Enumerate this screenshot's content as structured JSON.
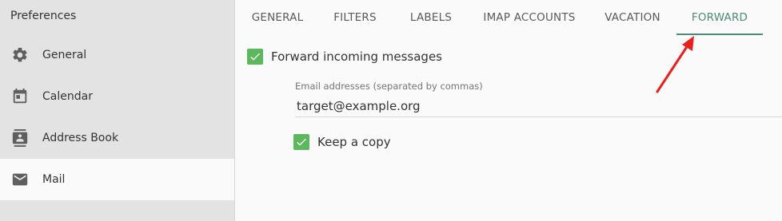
{
  "sidebar": {
    "title": "Preferences",
    "items": [
      {
        "label": "General",
        "icon": "gear-icon"
      },
      {
        "label": "Calendar",
        "icon": "calendar-icon"
      },
      {
        "label": "Address Book",
        "icon": "contacts-icon"
      },
      {
        "label": "Mail",
        "icon": "mail-icon",
        "active": true
      }
    ]
  },
  "tabs": [
    {
      "label": "GENERAL"
    },
    {
      "label": "FILTERS"
    },
    {
      "label": "LABELS"
    },
    {
      "label": "IMAP ACCOUNTS"
    },
    {
      "label": "VACATION"
    },
    {
      "label": "FORWARD",
      "active": true
    }
  ],
  "forward": {
    "enable_label": "Forward incoming messages",
    "enable_checked": true,
    "addresses_label": "Email addresses (separated by commas)",
    "addresses_value": "target@example.org",
    "keep_copy_label": "Keep a copy",
    "keep_copy_checked": true
  },
  "colors": {
    "accent": "#4e8a79",
    "checkbox": "#5cb85c",
    "annotation_arrow": "#e8201e"
  }
}
